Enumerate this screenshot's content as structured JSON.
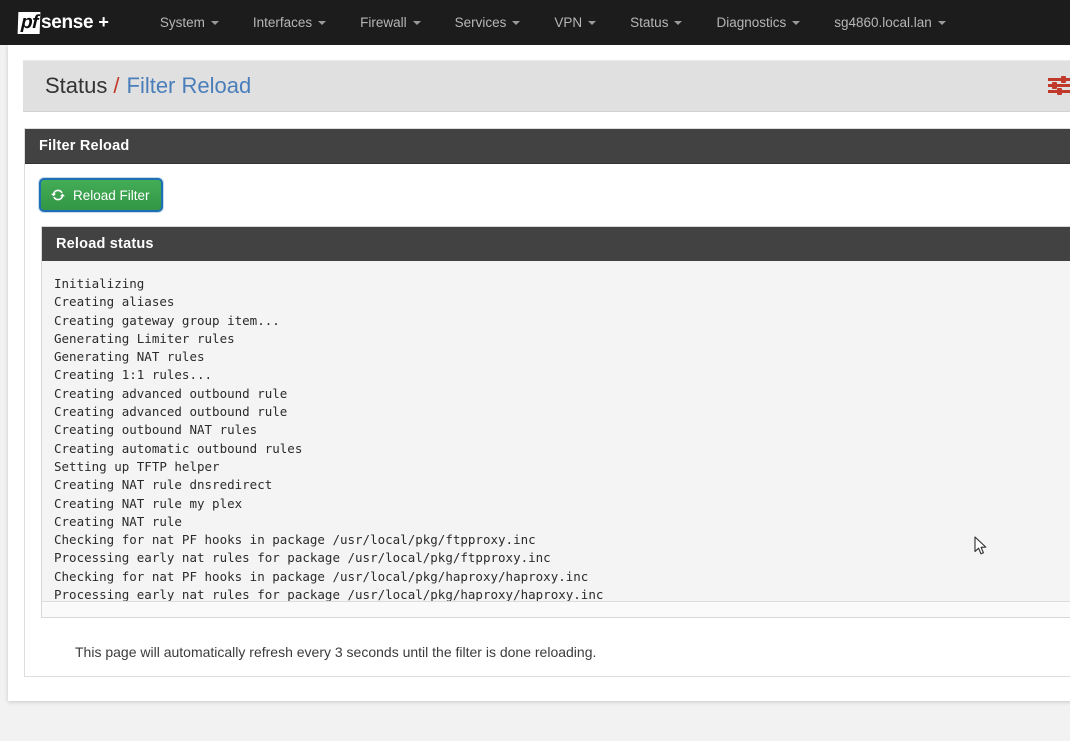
{
  "navbar": {
    "brand": {
      "pf": "pf",
      "sense": "sense",
      "plus": "+"
    },
    "items": [
      {
        "label": "System",
        "caret": true
      },
      {
        "label": "Interfaces",
        "caret": true
      },
      {
        "label": "Firewall",
        "caret": true
      },
      {
        "label": "Services",
        "caret": true
      },
      {
        "label": "VPN",
        "caret": true
      },
      {
        "label": "Status",
        "caret": true
      },
      {
        "label": "Diagnostics",
        "caret": true
      },
      {
        "label": "sg4860.local.lan",
        "caret": true
      }
    ]
  },
  "breadcrumb": {
    "root": "Status",
    "separator": "/",
    "current": "Filter Reload",
    "icon": "sliders-icon"
  },
  "panel": {
    "title": "Filter Reload",
    "reload_button": {
      "label": "Reload Filter",
      "icon": "refresh-icon"
    }
  },
  "reload_status": {
    "title": "Reload status",
    "lines": [
      "Initializing",
      "Creating aliases",
      "Creating gateway group item...",
      "Generating Limiter rules",
      "Generating NAT rules",
      "Creating 1:1 rules...",
      "Creating advanced outbound rule",
      "Creating advanced outbound rule",
      "Creating outbound NAT rules",
      "Creating automatic outbound rules",
      "Setting up TFTP helper",
      "Creating NAT rule dnsredirect",
      "Creating NAT rule my plex",
      "Creating NAT rule",
      "Checking for nat PF hooks in package /usr/local/pkg/ftpproxy.inc",
      "Processing early nat rules for package /usr/local/pkg/ftpproxy.inc",
      "Checking for nat PF hooks in package /usr/local/pkg/haproxy/haproxy.inc",
      "Processing early nat rules for package /usr/local/pkg/haproxy/haproxy.inc"
    ]
  },
  "footer": {
    "note": "This page will automatically refresh every 3 seconds until the filter is done reloading."
  },
  "colors": {
    "navbar_bg": "#1c1c1c",
    "breadcrumb_bg": "#e0e0e0",
    "panel_heading_bg": "#424242",
    "link_blue": "#4a7ebb",
    "accent_red": "#c0392b",
    "button_green": "#39a34d",
    "focus_blue": "#1f6fb5"
  }
}
